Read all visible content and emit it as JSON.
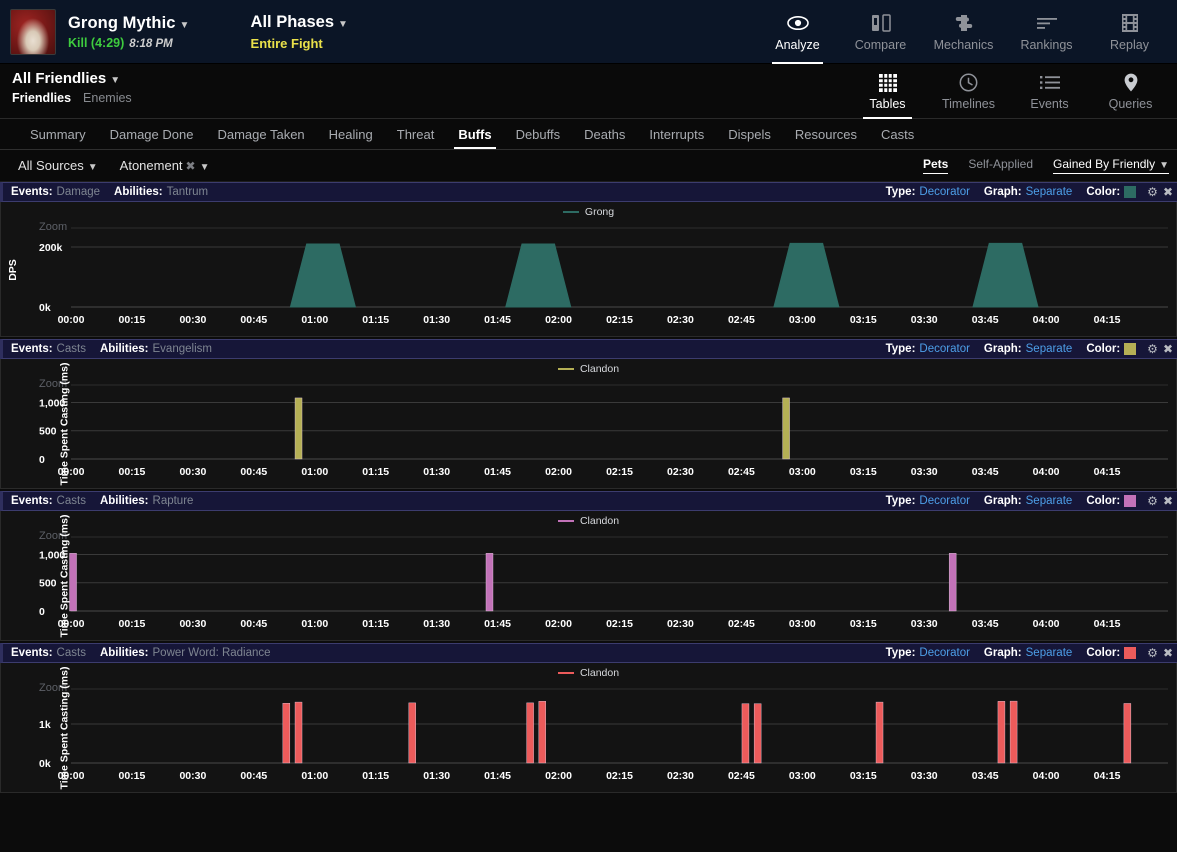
{
  "header": {
    "boss_name": "Grong Mythic",
    "kill_status": "Kill (4:29)",
    "kill_time": "8:18 PM",
    "phase_name": "All Phases",
    "phase_sub": "Entire Fight",
    "nav": [
      {
        "label": "Analyze",
        "icon": "eye-icon",
        "active": true
      },
      {
        "label": "Compare",
        "icon": "compare-icon",
        "active": false
      },
      {
        "label": "Mechanics",
        "icon": "puzzle-icon",
        "active": false
      },
      {
        "label": "Rankings",
        "icon": "bars-icon",
        "active": false
      },
      {
        "label": "Replay",
        "icon": "film-icon",
        "active": false
      }
    ]
  },
  "subheader": {
    "source_title": "All Friendlies",
    "toggles": [
      {
        "label": "Friendlies",
        "active": true
      },
      {
        "label": "Enemies",
        "active": false
      }
    ],
    "nav": [
      {
        "label": "Tables",
        "icon": "grid-icon",
        "active": true
      },
      {
        "label": "Timelines",
        "icon": "clock-icon",
        "active": false
      },
      {
        "label": "Events",
        "icon": "list-icon",
        "active": false
      },
      {
        "label": "Queries",
        "icon": "pin-icon",
        "active": false
      }
    ]
  },
  "tabs": [
    {
      "label": "Summary",
      "active": false
    },
    {
      "label": "Damage Done",
      "active": false
    },
    {
      "label": "Damage Taken",
      "active": false
    },
    {
      "label": "Healing",
      "active": false
    },
    {
      "label": "Threat",
      "active": false
    },
    {
      "label": "Buffs",
      "active": true
    },
    {
      "label": "Debuffs",
      "active": false
    },
    {
      "label": "Deaths",
      "active": false
    },
    {
      "label": "Interrupts",
      "active": false
    },
    {
      "label": "Dispels",
      "active": false
    },
    {
      "label": "Resources",
      "active": false
    },
    {
      "label": "Casts",
      "active": false
    }
  ],
  "filterbar": {
    "sources_label": "All Sources",
    "ability_label": "Atonement",
    "ability_clear_icon": "close-x-icon",
    "right": [
      {
        "label": "Pets",
        "style": "active"
      },
      {
        "label": "Self-Applied",
        "style": "inactive"
      },
      {
        "label": "Gained By Friendly",
        "style": "underlined"
      }
    ]
  },
  "panel_labels": {
    "events_key": "Events:",
    "abilities_key": "Abilities:",
    "type_key": "Type:",
    "type_val": "Decorator",
    "graph_key": "Graph:",
    "graph_val": "Separate",
    "color_key": "Color:",
    "gear_icon": "gear-icon",
    "close_icon": "close-x-icon",
    "zoom_label": "Zoom"
  },
  "chart_data": [
    {
      "type": "area",
      "panel_index": 0,
      "events": "Damage",
      "ability": "Tantrum",
      "color": "#2d6b63",
      "legend": "Grong",
      "ylabel": "DPS",
      "ytick_labels": [
        "200k",
        "0k"
      ],
      "ytick_values": [
        200000,
        0
      ],
      "ylim": [
        0,
        290000
      ],
      "xlim": [
        0,
        270
      ],
      "xtick_labels": [
        "00:00",
        "00:15",
        "00:30",
        "00:45",
        "01:00",
        "01:15",
        "01:30",
        "01:45",
        "02:00",
        "02:15",
        "02:30",
        "02:45",
        "03:00",
        "03:15",
        "03:30",
        "03:45",
        "04:00",
        "04:15"
      ],
      "xtick_seconds": [
        0,
        15,
        30,
        45,
        60,
        75,
        90,
        105,
        120,
        135,
        150,
        165,
        180,
        195,
        210,
        225,
        240,
        255
      ],
      "plateaus": [
        {
          "start": 54,
          "rise_end": 58,
          "fall_start": 66,
          "end": 70,
          "value": 210000
        },
        {
          "start": 107,
          "rise_end": 111,
          "fall_start": 119,
          "end": 123,
          "value": 210000
        },
        {
          "start": 173,
          "rise_end": 177,
          "fall_start": 185,
          "end": 189,
          "value": 212000
        },
        {
          "start": 222,
          "rise_end": 226,
          "fall_start": 234,
          "end": 238,
          "value": 212000
        }
      ]
    },
    {
      "type": "bar",
      "panel_index": 1,
      "events": "Casts",
      "ability": "Evangelism",
      "color": "#b5b055",
      "legend": "Clandon",
      "ylabel": "Time Spent Casting (ms)",
      "ytick_labels": [
        "1,000",
        "500",
        "0"
      ],
      "ytick_values": [
        1000,
        500,
        0
      ],
      "ylim": [
        0,
        1450
      ],
      "xlim": [
        0,
        270
      ],
      "xtick_labels": [
        "00:00",
        "00:15",
        "00:30",
        "00:45",
        "01:00",
        "01:15",
        "01:30",
        "01:45",
        "02:00",
        "02:15",
        "02:30",
        "02:45",
        "03:00",
        "03:15",
        "03:30",
        "03:45",
        "04:00",
        "04:15"
      ],
      "xtick_seconds": [
        0,
        15,
        30,
        45,
        60,
        75,
        90,
        105,
        120,
        135,
        150,
        165,
        180,
        195,
        210,
        225,
        240,
        255
      ],
      "bars": [
        {
          "x": 56,
          "value": 1080
        },
        {
          "x": 176,
          "value": 1080
        }
      ]
    },
    {
      "type": "bar",
      "panel_index": 2,
      "events": "Casts",
      "ability": "Rapture",
      "color": "#c272b8",
      "legend": "Clandon",
      "ylabel": "Time Spent Casting (ms)",
      "ytick_labels": [
        "1,000",
        "500",
        "0"
      ],
      "ytick_values": [
        1000,
        500,
        0
      ],
      "ylim": [
        0,
        1450
      ],
      "xlim": [
        0,
        270
      ],
      "xtick_labels": [
        "00:00",
        "00:15",
        "00:30",
        "00:45",
        "01:00",
        "01:15",
        "01:30",
        "01:45",
        "02:00",
        "02:15",
        "02:30",
        "02:45",
        "03:00",
        "03:15",
        "03:30",
        "03:45",
        "04:00",
        "04:15"
      ],
      "xtick_seconds": [
        0,
        15,
        30,
        45,
        60,
        75,
        90,
        105,
        120,
        135,
        150,
        165,
        180,
        195,
        210,
        225,
        240,
        255
      ],
      "bars": [
        {
          "x": 0.5,
          "value": 1020
        },
        {
          "x": 103,
          "value": 1020
        },
        {
          "x": 217,
          "value": 1020
        }
      ]
    },
    {
      "type": "bar",
      "panel_index": 3,
      "events": "Casts",
      "ability": "Power Word: Radiance",
      "color": "#ec5b5b",
      "legend": "Clandon",
      "ylabel": "Time Spent Casting (ms)",
      "ytick_labels": [
        "1k",
        "0k"
      ],
      "ytick_values": [
        1000,
        0
      ],
      "ylim": [
        0,
        2100
      ],
      "xlim": [
        0,
        270
      ],
      "xtick_labels": [
        "00:00",
        "00:15",
        "00:30",
        "00:45",
        "01:00",
        "01:15",
        "01:30",
        "01:45",
        "02:00",
        "02:15",
        "02:30",
        "02:45",
        "03:00",
        "03:15",
        "03:30",
        "03:45",
        "04:00",
        "04:15"
      ],
      "xtick_seconds": [
        0,
        15,
        30,
        45,
        60,
        75,
        90,
        105,
        120,
        135,
        150,
        165,
        180,
        195,
        210,
        225,
        240,
        255
      ],
      "bars": [
        {
          "x": 53,
          "value": 1530
        },
        {
          "x": 56,
          "value": 1560
        },
        {
          "x": 84,
          "value": 1540
        },
        {
          "x": 113,
          "value": 1540
        },
        {
          "x": 116,
          "value": 1580
        },
        {
          "x": 166,
          "value": 1520
        },
        {
          "x": 169,
          "value": 1520
        },
        {
          "x": 199,
          "value": 1560
        },
        {
          "x": 229,
          "value": 1580
        },
        {
          "x": 232,
          "value": 1585
        },
        {
          "x": 260,
          "value": 1525
        }
      ]
    }
  ]
}
